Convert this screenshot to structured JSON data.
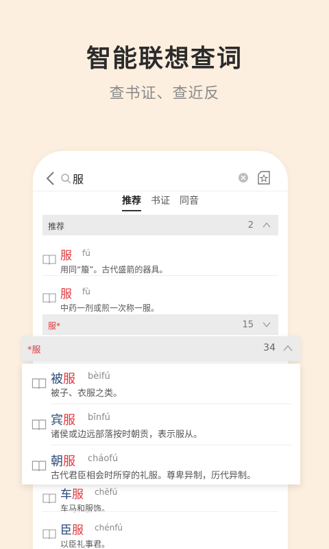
{
  "promo": {
    "headline": "智能联想查词",
    "subline": "查书证、查近反"
  },
  "search": {
    "query": "服"
  },
  "tabs": [
    {
      "label": "推荐"
    },
    {
      "label": "书证"
    },
    {
      "label": "同音"
    }
  ],
  "sections": {
    "recommended": {
      "title": "推荐",
      "count": "2",
      "entries": [
        {
          "head": "服",
          "pinyin": "fú",
          "definition": "用同“箙”。古代盛箭的器具。"
        },
        {
          "head": "服",
          "pinyin": "fù",
          "definition": "中药一剂或煎一次称一服。"
        }
      ]
    },
    "prefix": {
      "title": "服*",
      "count": "15"
    },
    "suffix": {
      "title": "*服",
      "count": "34",
      "entries": [
        {
          "pre": "被",
          "head": "服",
          "pinyin": "bèifú",
          "definition": "被子、衣服之类。"
        },
        {
          "pre": "宾",
          "head": "服",
          "pinyin": "bīnfú",
          "definition": "诸侯或边远部落按时朝贡，表示服从。"
        },
        {
          "pre": "朝",
          "head": "服",
          "pinyin": "cháofú",
          "definition": "古代君臣相会时所穿的礼服。尊卑异制，历代异制。"
        }
      ]
    },
    "underlying": {
      "entries": [
        {
          "pre": "车",
          "head": "服",
          "pinyin": "chēfú",
          "definition": "车马和服饰。"
        },
        {
          "pre": "臣",
          "head": "服",
          "pinyin": "chénfú",
          "definition": "以臣礼事君。"
        }
      ]
    }
  },
  "colors": {
    "accent": "#e0383e",
    "word": "#2b4a7a",
    "background": "#fcefdf"
  }
}
